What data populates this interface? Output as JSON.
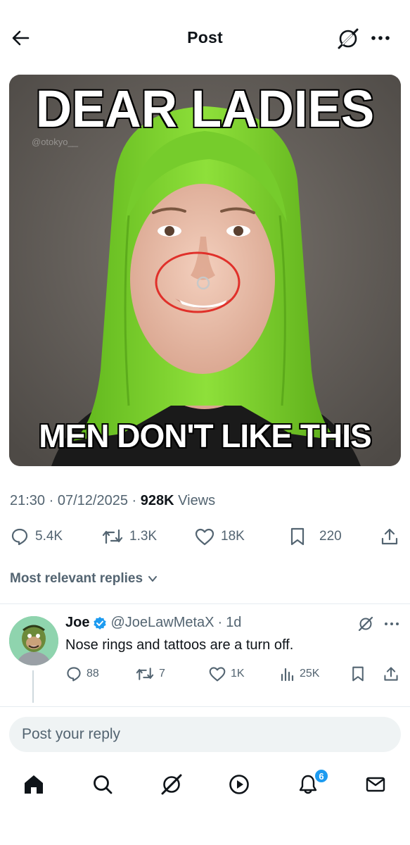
{
  "header": {
    "title": "Post",
    "icons": {
      "back": "arrow-left-icon",
      "grok": "grok-icon",
      "more": "more-horizontal-icon"
    }
  },
  "media": {
    "top_caption": "DEAR LADIES",
    "bottom_caption": "MEN DON'T LIKE THIS",
    "watermark": "@otokyo__"
  },
  "post_meta": {
    "time": "21:30",
    "separator": "·",
    "date": "07/12/2025",
    "views_count": "928K",
    "views_label": "Views"
  },
  "actions": {
    "replies": "5.4K",
    "reposts": "1.3K",
    "likes": "18K",
    "bookmarks": "220"
  },
  "sort": {
    "label": "Most relevant replies"
  },
  "reply": {
    "name": "Joe",
    "handle": "@JoeLawMetaX",
    "time": "1d",
    "separator": "·",
    "text": "Nose rings and tattoos are a turn off.",
    "replies": "88",
    "reposts": "7",
    "likes": "1K",
    "views": "25K"
  },
  "composer": {
    "placeholder": "Post your reply"
  },
  "nav": {
    "items": [
      "home-icon",
      "search-icon",
      "grok-icon",
      "video-icon",
      "notifications-icon",
      "messages-icon"
    ],
    "notifications_badge": "6"
  },
  "colors": {
    "accent": "#1d9bf0",
    "text": "#0f1419",
    "secondary": "#536471",
    "hair": "#7ed321",
    "circle": "#e0302a"
  }
}
